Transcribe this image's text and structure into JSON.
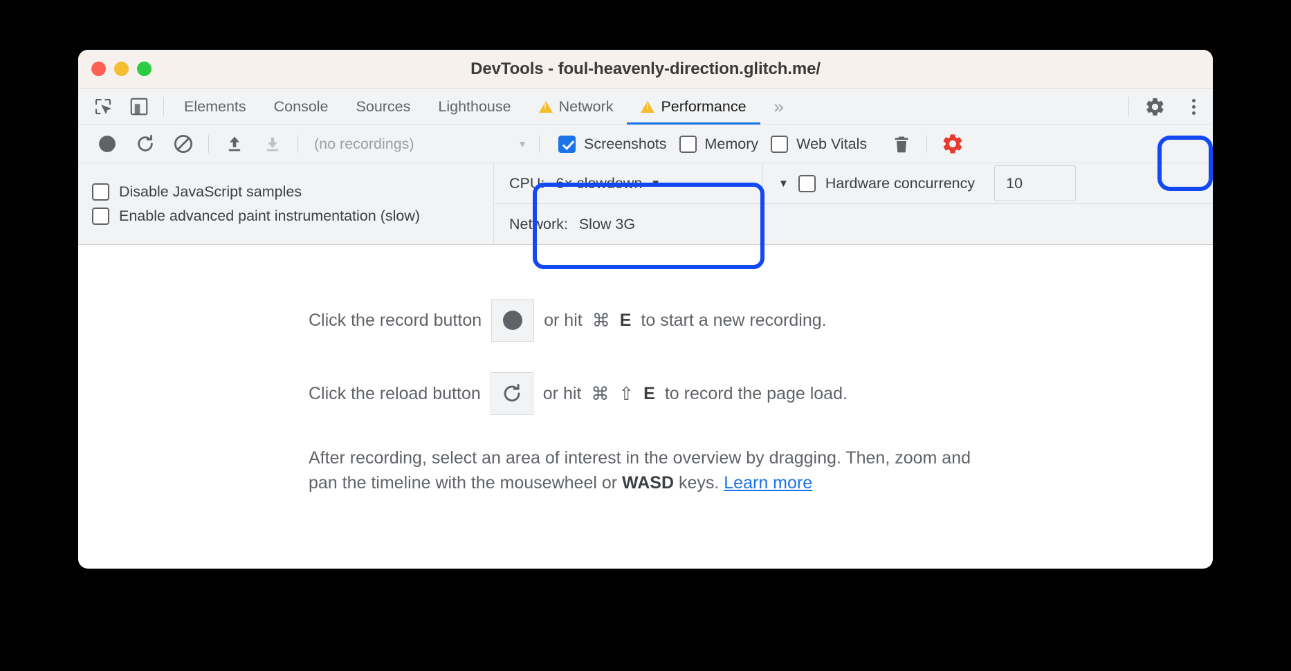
{
  "window": {
    "title": "DevTools - foul-heavenly-direction.glitch.me/",
    "traffic_lights": [
      "close-red",
      "minimize-yellow",
      "zoom-green"
    ]
  },
  "tabbar": {
    "left_icons": [
      {
        "name": "inspect-element-icon",
        "label": "Inspect element"
      },
      {
        "name": "device-toolbar-icon",
        "label": "Toggle device toolbar"
      }
    ],
    "tabs": [
      {
        "label": "Elements",
        "selected": false,
        "warning": false
      },
      {
        "label": "Console",
        "selected": false,
        "warning": false
      },
      {
        "label": "Sources",
        "selected": false,
        "warning": false
      },
      {
        "label": "Lighthouse",
        "selected": false,
        "warning": false
      },
      {
        "label": "Network",
        "selected": false,
        "warning": true
      },
      {
        "label": "Performance",
        "selected": true,
        "warning": true
      }
    ],
    "overflow_label": "»",
    "right_icons": [
      {
        "name": "settings-gear-icon",
        "label": "Settings"
      },
      {
        "name": "more-options-icon",
        "label": "Customize and control DevTools"
      }
    ]
  },
  "toolbar": {
    "record_label": "Record",
    "reload_label": "Start profiling and reload page",
    "clear_label": "Clear",
    "load_profile_label": "Load profile",
    "save_profile_label": "Save profile",
    "recordings_value": "(no recordings)",
    "recordings_caret": "▼",
    "checkboxes": [
      {
        "label": "Screenshots",
        "checked": true
      },
      {
        "label": "Memory",
        "checked": false
      },
      {
        "label": "Web Vitals",
        "checked": false
      }
    ],
    "trash_label": "Collect garbage",
    "capture_settings_label": "Capture settings",
    "capture_settings_active": true,
    "accent_blue": "#1a73e8",
    "gear_red": "#e8392c"
  },
  "settings": {
    "disable_js_samples": {
      "label": "Disable JavaScript samples",
      "checked": false
    },
    "advanced_paint": {
      "label": "Enable advanced paint instrumentation (slow)",
      "checked": false
    },
    "cpu": {
      "key": "CPU:",
      "value": "6× slowdown",
      "caret": "▼"
    },
    "network": {
      "key": "Network:",
      "value": "Slow 3G",
      "caret": "▼"
    },
    "hardware_concurrency": {
      "label": "Hardware concurrency",
      "checked": false,
      "value": "10"
    }
  },
  "body": {
    "hint_record": {
      "before": "Click the record button",
      "icon": "record-dot-icon",
      "after_1": "or hit",
      "key_cmd": "⌘",
      "key_letter": "E",
      "after_2": "to start a new recording."
    },
    "hint_reload": {
      "before": "Click the reload button",
      "icon": "reload-icon",
      "after_1": "or hit",
      "key_cmd": "⌘",
      "key_shift": "⇧",
      "key_letter": "E",
      "after_2": "to record the page load."
    },
    "paragraph": {
      "part_1": "After recording, select an area of interest in the overview by dragging. Then, zoom and pan the timeline with the mousewheel or ",
      "bold": "WASD",
      "part_2": " keys. ",
      "link": "Learn more"
    }
  },
  "annotations": [
    {
      "name": "gear-highlight",
      "color": "#1348f5",
      "target": "capture-settings-button"
    },
    {
      "name": "throttling-highlight",
      "color": "#1348f5",
      "target": "cpu-network-throttle-group"
    }
  ]
}
